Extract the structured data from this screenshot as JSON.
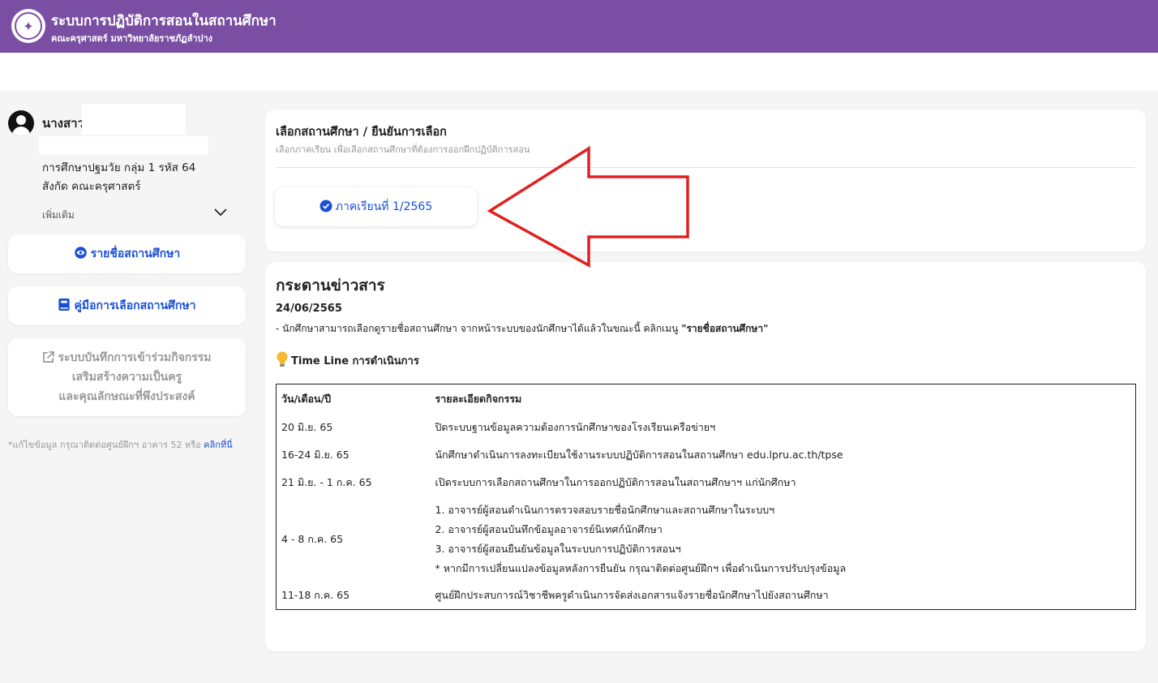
{
  "header": {
    "title": "ระบบการปฏิบัติการสอนในสถานศึกษา",
    "subtitle": "คณะครุศาสตร์ มหาวิทยาลัยราชภัฏลำปาง"
  },
  "user": {
    "name_prefix": "นางสาว",
    "major": "การศึกษาปฐมวัย กลุ่ม 1 รหัส 64",
    "faculty": "สังกัด คณะครุศาสตร์",
    "more_label": "เพิ่มเติม"
  },
  "sidebar": {
    "school_list_label": "รายชื่อสถานศึกษา",
    "guide_label": "คู่มือการเลือกสถานศึกษา",
    "record_lines": [
      "ระบบบันทึกการเข้าร่วมกิจกรรม",
      "เสริมสร้างความเป็นครู",
      "และคุณลักษณะที่พึงประสงค์"
    ],
    "note_text": "*แก้ไขข้อมูล กรุณาติดต่อศูนย์ฝึกฯ อาคาร 52 หรือ ",
    "note_link": "คลิกที่นี่"
  },
  "select_card": {
    "title": "เลือกสถานศึกษา / ยืนยันการเลือก",
    "subtitle": "เลือกภาคเรียน เพื่อเลือกสถานศึกษาที่ต้องการออกฝึกปฏิบัติการสอน",
    "semester_label": "ภาคเรียนที่ 1/2565"
  },
  "news": {
    "title": "กระดานข่าวสาร",
    "date": "24/06/2565",
    "text": "- นักศึกษาสามารถเลือกดูรายชื่อสถานศึกษา จากหน้าระบบของนักศึกษาได้แล้วในขณะนี้ คลิกเมนู ",
    "text_bold": "\"รายชื่อสถานศึกษา\"",
    "timeline_title": "Time Line การดำเนินการ",
    "table_headers": [
      "วัน/เดือน/ปี",
      "รายละเอียดกิจกรรม"
    ],
    "rows": [
      {
        "date": "20 มิ.ย. 65",
        "detail": "ปิดระบบฐานข้อมูลความต้องการนักศึกษาของโรงเรียนเครือข่ายฯ"
      },
      {
        "date": "16-24 มิ.ย. 65",
        "detail": "นักศึกษาดำเนินการลงทะเบียนใช้งานระบบปฏิบัติการสอนในสถานศึกษา edu.lpru.ac.th/tpse"
      },
      {
        "date": "21 มิ.ย. - 1 ก.ค. 65",
        "detail": "เปิดระบบการเลือกสถานศึกษาในการออกปฏิบัติการสอนในสถานศึกษาฯ แก่นักศึกษา"
      },
      {
        "date": "4 - 8 ก.ค. 65",
        "detail_lines": [
          "1. อาจารย์ผู้สอนดำเนินการตรวจสอบรายชื่อนักศึกษาและสถานศึกษาในระบบฯ",
          "2. อาจารย์ผู้สอนบันทึกข้อมูลอาจารย์นิเทศก์นักศึกษา",
          "3. อาจารย์ผู้สอนยืนยันข้อมูลในระบบการปฏิบัติการสอนฯ",
          "* หากมีการเปลี่ยนแปลงข้อมูลหลังการยืนยัน กรุณาติดต่อศูนย์ฝึกฯ เพื่อดำเนินการปรับปรุงข้อมูล"
        ]
      },
      {
        "date": "11-18 ก.ค. 65",
        "detail": "ศูนย์ฝึกประสบการณ์วิชาชีพครูดำเนินการจัดส่งเอกสารแจ้งรายชื่อนักศึกษาไปยังสถานศึกษา"
      }
    ]
  },
  "colors": {
    "brand": "#7a4fa3",
    "link": "#1a4fd8",
    "annotation_arrow": "#e02020"
  },
  "icons": [
    "user-icon",
    "chevron-down-icon",
    "eye-icon",
    "book-icon",
    "external-link-icon",
    "check-circle-icon",
    "lightbulb-icon"
  ]
}
